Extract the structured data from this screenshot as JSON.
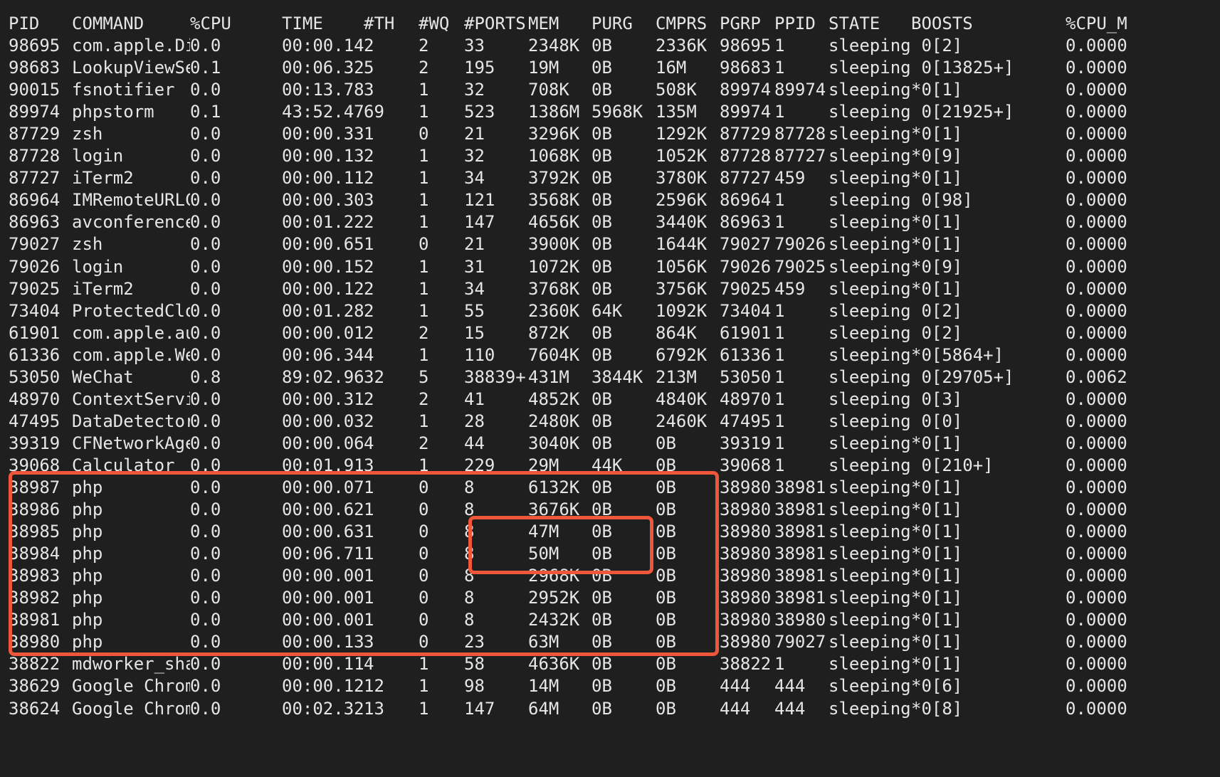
{
  "colors": {
    "background": "#1e1f1e",
    "text": "#e6e6e6",
    "highlight": "#f0563a"
  },
  "table": {
    "columns": [
      "PID",
      "COMMAND",
      "%CPU",
      "TIME",
      "#TH",
      "#WQ",
      "#PORTS",
      "MEM",
      "PURG",
      "CMPRS",
      "PGRP",
      "PPID",
      "STATE",
      "BOOSTS",
      "%CPU_M"
    ],
    "rows": [
      [
        "98695",
        "com.apple.Di",
        "0.0",
        "00:00.14",
        "2",
        "2",
        "33",
        "2348K",
        "0B",
        "2336K",
        "98695",
        "1",
        "sleeping",
        " 0[2]",
        "0.0000"
      ],
      [
        "98683",
        "LookupViewSe",
        "0.1",
        "00:06.32",
        "5",
        "2",
        "195",
        "19M",
        "0B",
        "16M",
        "98683",
        "1",
        "sleeping",
        " 0[13825+]",
        "0.0000"
      ],
      [
        "90015",
        "fsnotifier",
        "0.0",
        "00:13.78",
        "3",
        "1",
        "32",
        "708K",
        "0B",
        "508K",
        "89974",
        "89974",
        "sleeping",
        "*0[1]",
        "0.0000"
      ],
      [
        "89974",
        "phpstorm",
        "0.1",
        "43:52.47",
        "69",
        "1",
        "523",
        "1386M",
        "5968K",
        "135M",
        "89974",
        "1",
        "sleeping",
        " 0[21925+]",
        "0.0000"
      ],
      [
        "87729",
        "zsh",
        "0.0",
        "00:00.33",
        "1",
        "0",
        "21",
        "3296K",
        "0B",
        "1292K",
        "87729",
        "87728",
        "sleeping",
        "*0[1]",
        "0.0000"
      ],
      [
        "87728",
        "login",
        "0.0",
        "00:00.13",
        "2",
        "1",
        "32",
        "1068K",
        "0B",
        "1052K",
        "87728",
        "87727",
        "sleeping",
        "*0[9]",
        "0.0000"
      ],
      [
        "87727",
        "iTerm2",
        "0.0",
        "00:00.11",
        "2",
        "1",
        "34",
        "3792K",
        "0B",
        "3780K",
        "87727",
        "459",
        "sleeping",
        "*0[1]",
        "0.0000"
      ],
      [
        "86964",
        "IMRemoteURLC",
        "0.0",
        "00:00.30",
        "3",
        "1",
        "121",
        "3568K",
        "0B",
        "2596K",
        "86964",
        "1",
        "sleeping",
        " 0[98]",
        "0.0000"
      ],
      [
        "86963",
        "avconference",
        "0.0",
        "00:01.22",
        "2",
        "1",
        "147",
        "4656K",
        "0B",
        "3440K",
        "86963",
        "1",
        "sleeping",
        "*0[1]",
        "0.0000"
      ],
      [
        "79027",
        "zsh",
        "0.0",
        "00:00.65",
        "1",
        "0",
        "21",
        "3900K",
        "0B",
        "1644K",
        "79027",
        "79026",
        "sleeping",
        "*0[1]",
        "0.0000"
      ],
      [
        "79026",
        "login",
        "0.0",
        "00:00.15",
        "2",
        "1",
        "31",
        "1072K",
        "0B",
        "1056K",
        "79026",
        "79025",
        "sleeping",
        "*0[9]",
        "0.0000"
      ],
      [
        "79025",
        "iTerm2",
        "0.0",
        "00:00.12",
        "2",
        "1",
        "34",
        "3768K",
        "0B",
        "3756K",
        "79025",
        "459",
        "sleeping",
        "*0[1]",
        "0.0000"
      ],
      [
        "73404",
        "ProtectedClo",
        "0.0",
        "00:01.28",
        "2",
        "1",
        "55",
        "2360K",
        "64K",
        "1092K",
        "73404",
        "1",
        "sleeping",
        " 0[2]",
        "0.0000"
      ],
      [
        "61901",
        "com.apple.au",
        "0.0",
        "00:00.01",
        "2",
        "2",
        "15",
        "872K",
        "0B",
        "864K",
        "61901",
        "1",
        "sleeping",
        " 0[2]",
        "0.0000"
      ],
      [
        "61336",
        "com.apple.We",
        "0.0",
        "00:06.34",
        "4",
        "1",
        "110",
        "7604K",
        "0B",
        "6792K",
        "61336",
        "1",
        "sleeping",
        "*0[5864+]",
        "0.0000"
      ],
      [
        "53050",
        "WeChat",
        "0.8",
        "89:02.96",
        "32",
        "5",
        "38839+",
        "431M",
        "3844K",
        "213M",
        "53050",
        "1",
        "sleeping",
        " 0[29705+]",
        "0.0062"
      ],
      [
        "48970",
        "ContextServi",
        "0.0",
        "00:00.31",
        "2",
        "2",
        "41",
        "4852K",
        "0B",
        "4840K",
        "48970",
        "1",
        "sleeping",
        " 0[3]",
        "0.0000"
      ],
      [
        "47495",
        "DataDetector",
        "0.0",
        "00:00.03",
        "2",
        "1",
        "28",
        "2480K",
        "0B",
        "2460K",
        "47495",
        "1",
        "sleeping",
        " 0[0]",
        "0.0000"
      ],
      [
        "39319",
        "CFNetworkAge",
        "0.0",
        "00:00.06",
        "4",
        "2",
        "44",
        "3040K",
        "0B",
        "0B",
        "39319",
        "1",
        "sleeping",
        "*0[1]",
        "0.0000"
      ],
      [
        "39068",
        "Calculator",
        "0.0",
        "00:01.91",
        "3",
        "1",
        "229",
        "29M",
        "44K",
        "0B",
        "39068",
        "1",
        "sleeping",
        " 0[210+]",
        "0.0000"
      ],
      [
        "38987",
        "php",
        "0.0",
        "00:00.07",
        "1",
        "0",
        "8",
        "6132K",
        "0B",
        "0B",
        "38980",
        "38981",
        "sleeping",
        "*0[1]",
        "0.0000"
      ],
      [
        "38986",
        "php",
        "0.0",
        "00:00.62",
        "1",
        "0",
        "8",
        "3676K",
        "0B",
        "0B",
        "38980",
        "38981",
        "sleeping",
        "*0[1]",
        "0.0000"
      ],
      [
        "38985",
        "php",
        "0.0",
        "00:00.63",
        "1",
        "0",
        "8",
        "47M",
        "0B",
        "0B",
        "38980",
        "38981",
        "sleeping",
        "*0[1]",
        "0.0000"
      ],
      [
        "38984",
        "php",
        "0.0",
        "00:06.71",
        "1",
        "0",
        "8",
        "50M",
        "0B",
        "0B",
        "38980",
        "38981",
        "sleeping",
        "*0[1]",
        "0.0000"
      ],
      [
        "38983",
        "php",
        "0.0",
        "00:00.00",
        "1",
        "0",
        "8",
        "2968K",
        "0B",
        "0B",
        "38980",
        "38981",
        "sleeping",
        "*0[1]",
        "0.0000"
      ],
      [
        "38982",
        "php",
        "0.0",
        "00:00.00",
        "1",
        "0",
        "8",
        "2952K",
        "0B",
        "0B",
        "38980",
        "38981",
        "sleeping",
        "*0[1]",
        "0.0000"
      ],
      [
        "38981",
        "php",
        "0.0",
        "00:00.00",
        "1",
        "0",
        "8",
        "2432K",
        "0B",
        "0B",
        "38980",
        "38980",
        "sleeping",
        "*0[1]",
        "0.0000"
      ],
      [
        "38980",
        "php",
        "0.0",
        "00:00.13",
        "3",
        "0",
        "23",
        "63M",
        "0B",
        "0B",
        "38980",
        "79027",
        "sleeping",
        "*0[1]",
        "0.0000"
      ],
      [
        "38822",
        "mdworker_sha",
        "0.0",
        "00:00.11",
        "4",
        "1",
        "58",
        "4636K",
        "0B",
        "0B",
        "38822",
        "1",
        "sleeping",
        "*0[1]",
        "0.0000"
      ],
      [
        "38629",
        "Google Chrom",
        "0.0",
        "00:00.12",
        "12",
        "1",
        "98",
        "14M",
        "0B",
        "0B",
        "444",
        "444",
        "sleeping",
        "*0[6]",
        "0.0000"
      ],
      [
        "38624",
        "Google Chrom",
        "0.0",
        "00:02.32",
        "13",
        "1",
        "147",
        "64M",
        "0B",
        "0B",
        "444",
        "444",
        "sleeping",
        "*0[8]",
        "0.0000"
      ]
    ]
  }
}
